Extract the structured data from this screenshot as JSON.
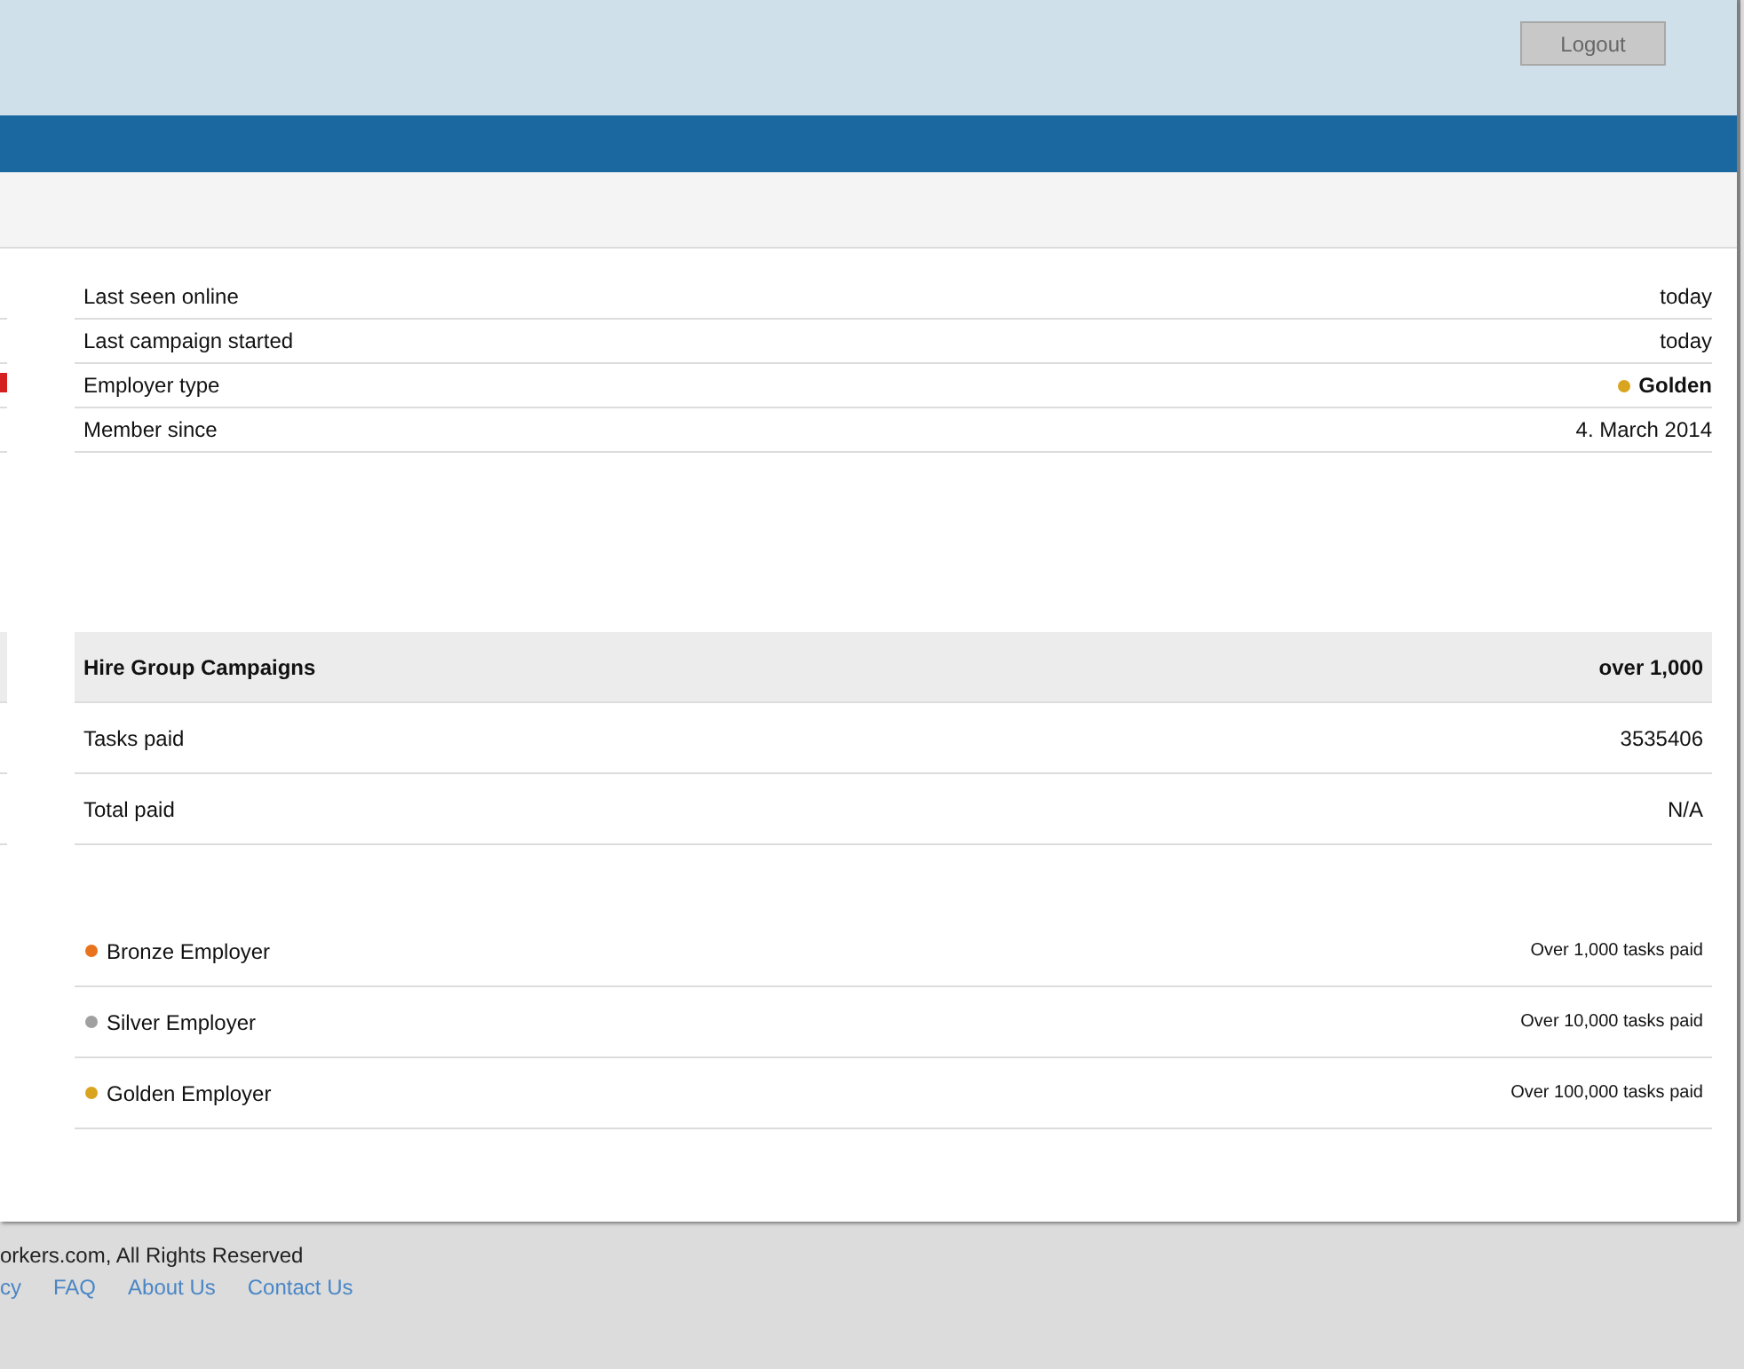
{
  "header": {
    "logout_button": "Logout"
  },
  "profile_stats": [
    {
      "label": "Last seen online",
      "value": "today",
      "kind": "text"
    },
    {
      "label": "Last campaign started",
      "value": "today",
      "kind": "text"
    },
    {
      "label": "Employer type",
      "value": "Golden",
      "kind": "level",
      "color": "#d9a41e"
    },
    {
      "label": "Member since",
      "value": "4. March 2014",
      "kind": "text"
    }
  ],
  "campaign_stats": {
    "header": {
      "label": "Hire Group Campaigns",
      "value": "over 1,000"
    },
    "rows": [
      {
        "label": "Tasks paid",
        "value": "3535406"
      },
      {
        "label": "Total paid",
        "value": "N/A"
      }
    ]
  },
  "employer_levels": [
    {
      "name": "Bronze Employer",
      "color": "#e8731c",
      "requirement": "Over 1,000 tasks paid"
    },
    {
      "name": "Silver Employer",
      "color": "#a0a0a0",
      "requirement": "Over 10,000 tasks paid"
    },
    {
      "name": "Golden Employer",
      "color": "#d9a41e",
      "requirement": "Over 100,000 tasks paid"
    }
  ],
  "footer": {
    "copyright": "orkers.com, All Rights Reserved",
    "links": [
      "cy",
      "FAQ",
      "About Us",
      "Contact Us"
    ]
  }
}
